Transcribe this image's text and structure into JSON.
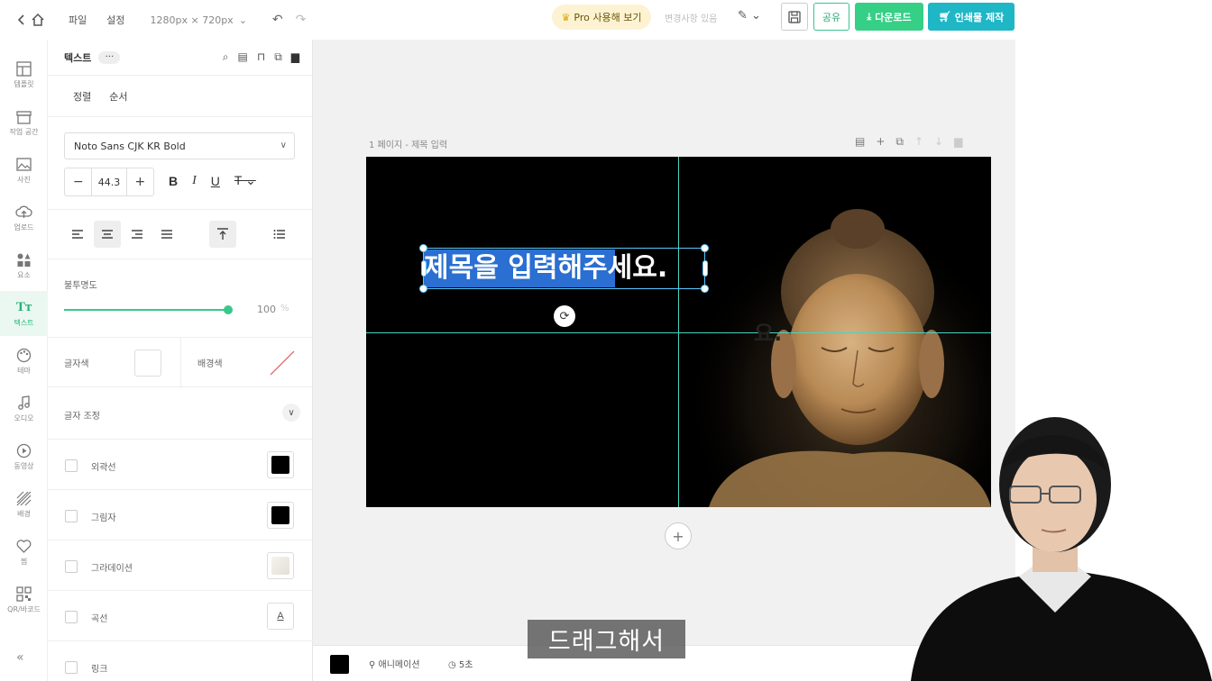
{
  "topbar": {
    "menu_file": "파일",
    "menu_settings": "설정",
    "canvas_size": "1280px × 720px",
    "pro_button": "Pro 사용해 보기",
    "changes_status": "변경사항 있음",
    "share_button": "공유",
    "download_button": "다운로드",
    "print_button": "인쇄물 제작"
  },
  "rail": {
    "items": [
      {
        "label": "템플릿",
        "icon": "template-icon"
      },
      {
        "label": "작업 공간",
        "icon": "workspace-icon"
      },
      {
        "label": "사진",
        "icon": "photo-icon"
      },
      {
        "label": "업로드",
        "icon": "upload-icon"
      },
      {
        "label": "요소",
        "icon": "elements-icon"
      },
      {
        "label": "텍스트",
        "icon": "text-icon"
      },
      {
        "label": "테마",
        "icon": "theme-icon"
      },
      {
        "label": "오디오",
        "icon": "audio-icon"
      },
      {
        "label": "동영상",
        "icon": "video-icon"
      },
      {
        "label": "배경",
        "icon": "background-icon"
      },
      {
        "label": "찜",
        "icon": "heart-icon"
      },
      {
        "label": "QR/바코드",
        "icon": "qr-icon"
      }
    ]
  },
  "panel": {
    "title": "텍스트",
    "more": "···",
    "tab_align": "정렬",
    "tab_order": "순서",
    "font_family": "Noto Sans CJK KR Bold",
    "font_size": "44.3",
    "opacity_label": "불투명도",
    "opacity_value": "100",
    "opacity_unit": "%",
    "opacity_fraction": 1.0,
    "text_color_label": "글자색",
    "bg_color_label": "배경색",
    "text_adjust_label": "글자 조정",
    "outline_label": "외곽선",
    "shadow_label": "그림자",
    "gradient_label": "그라데이션",
    "curve_label": "곡선",
    "link_label": "링크"
  },
  "canvas": {
    "page_label": "1 페이지 - 제목 입력",
    "title_selected": "제목을 입력해주",
    "title_rest": "세요.",
    "ghost_text": "요.",
    "background_color": "#000000",
    "guide_color": "#45d6c0"
  },
  "bottombar": {
    "animation_label": "애니메이션",
    "duration_label": "5초"
  },
  "caption": "드래그해서",
  "colors": {
    "accent_green": "#35cf86",
    "print_teal": "#1fb6c6",
    "selection_blue": "#2a6fd1"
  }
}
